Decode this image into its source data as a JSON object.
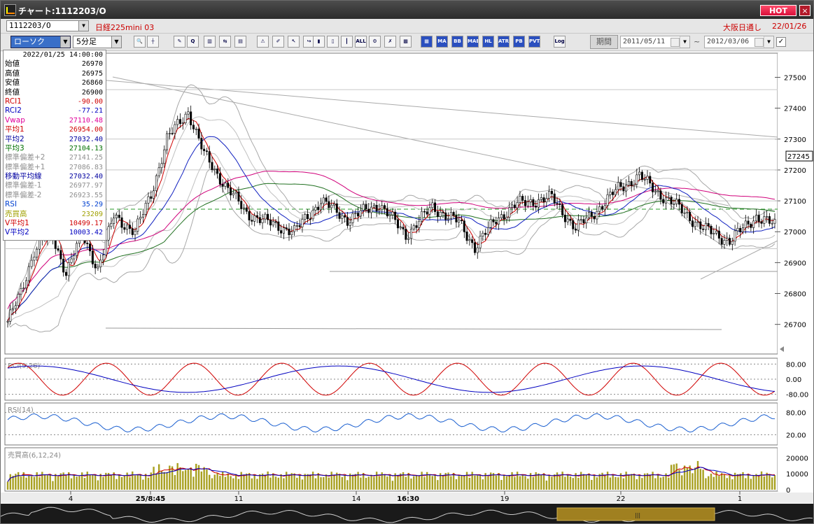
{
  "window": {
    "title": "チャート:1112203/O",
    "hot_label": "HOT",
    "close_label": "×"
  },
  "symbol": {
    "code": "1112203/O",
    "name": "日経225mini 03",
    "session": "大阪日通し",
    "date": "22/01/26"
  },
  "controls": {
    "chart_type": "ローソク",
    "interval": "5分足",
    "period_label": "期間",
    "date_from": "2011/05/11",
    "date_separator": "~",
    "date_to": "2012/03/06",
    "icons": [
      "search-icon",
      "crosshair-icon",
      "draw-icon",
      "zoom-icon",
      "chart-icon",
      "compare-icon",
      "memo-icon",
      "warning-icon",
      "pen-icon",
      "cursor-icon",
      "arrow-icon",
      "bar-icon",
      "bar2-icon",
      "candle-icon",
      "all-icon",
      "settings-icon",
      "tool-icon",
      "color-icon",
      "grid-icon",
      "ma-icon",
      "bb-icon",
      "mae-icon",
      "hl-icon",
      "atr-icon",
      "pb-icon",
      "pvt-icon",
      "log-icon"
    ],
    "icon_labels": [
      "🔍",
      "┼",
      "✎",
      "Q",
      "▥",
      "⇆",
      "▤",
      "⚠",
      "✐",
      "↖",
      "↪",
      "▮",
      "▯",
      "┃",
      "ALL",
      "⚙",
      "✗",
      "▩",
      "▦",
      "MA",
      "BB",
      "MAE",
      "HL",
      "ATR",
      "PB",
      "PVT",
      "Log"
    ]
  },
  "info_panel": {
    "timestamp": "2022/01/25  14:00:00",
    "rows": [
      {
        "label": "始値",
        "value": "26970",
        "color": "#000000"
      },
      {
        "label": "高値",
        "value": "26975",
        "color": "#000000"
      },
      {
        "label": "安値",
        "value": "26860",
        "color": "#000000"
      },
      {
        "label": "終値",
        "value": "26900",
        "color": "#000000"
      },
      {
        "label": "RCI1",
        "value": "-90.00",
        "color": "#d00000"
      },
      {
        "label": "RCI2",
        "value": "-77.21",
        "color": "#0000c0"
      },
      {
        "label": "Vwap",
        "value": "27110.48",
        "color": "#e0009a"
      },
      {
        "label": "平均1",
        "value": "26954.00",
        "color": "#d00000"
      },
      {
        "label": "平均2",
        "value": "27032.40",
        "color": "#0000a0"
      },
      {
        "label": "平均3",
        "value": "27104.13",
        "color": "#007000"
      },
      {
        "label": "標準偏差+2",
        "value": "27141.25",
        "color": "#909090"
      },
      {
        "label": "標準偏差+1",
        "value": "27086.83",
        "color": "#909090"
      },
      {
        "label": "移動平均線",
        "value": "27032.40",
        "color": "#0000a0"
      },
      {
        "label": "標準偏差-1",
        "value": "26977.97",
        "color": "#909090"
      },
      {
        "label": "標準偏差-2",
        "value": "26923.55",
        "color": "#909090"
      },
      {
        "label": "RSI",
        "value": "35.29",
        "color": "#0040d0"
      },
      {
        "label": "売買高",
        "value": "23209",
        "color": "#a0a000"
      },
      {
        "label": "V平均1",
        "value": "10499.17",
        "color": "#d00000"
      },
      {
        "label": "V平均2",
        "value": "10003.42",
        "color": "#0000c0"
      }
    ]
  },
  "chart_data": [
    {
      "type": "candlestick",
      "ylim": [
        26620,
        27560
      ],
      "y_ticks": [
        "27500",
        "27400",
        "27300",
        "27200",
        "27100",
        "27000",
        "26900",
        "26800",
        "26700"
      ],
      "current_price": "27245",
      "x_ticks": [
        "4",
        "25/8:45",
        "11",
        "14",
        "16:30",
        "19",
        "22",
        "1"
      ],
      "num_bars": 290,
      "path": [
        [
          0,
          26710
        ],
        [
          5,
          26800
        ],
        [
          10,
          26940
        ],
        [
          16,
          27000
        ],
        [
          22,
          26870
        ],
        [
          28,
          26990
        ],
        [
          34,
          26880
        ],
        [
          40,
          27050
        ],
        [
          48,
          27000
        ],
        [
          54,
          27120
        ],
        [
          60,
          27300
        ],
        [
          68,
          27390
        ],
        [
          74,
          27250
        ],
        [
          82,
          27150
        ],
        [
          90,
          27060
        ],
        [
          98,
          27030
        ],
        [
          108,
          27000
        ],
        [
          118,
          27100
        ],
        [
          128,
          27040
        ],
        [
          140,
          27090
        ],
        [
          150,
          26990
        ],
        [
          160,
          27080
        ],
        [
          170,
          27030
        ],
        [
          176,
          26950
        ],
        [
          184,
          27040
        ],
        [
          192,
          27090
        ],
        [
          205,
          27110
        ],
        [
          214,
          27010
        ],
        [
          222,
          27070
        ],
        [
          230,
          27140
        ],
        [
          238,
          27180
        ],
        [
          246,
          27120
        ],
        [
          254,
          27070
        ],
        [
          262,
          27010
        ],
        [
          272,
          26970
        ],
        [
          282,
          27050
        ],
        [
          289,
          27020
        ]
      ],
      "lines": {
        "rci_title": "RCI(9,26)",
        "rci_ticks": [
          "80.00",
          "0.00",
          "-80.00"
        ],
        "rsi_title": "RSI(14)",
        "rsi_ticks": [
          "80.00",
          "20.00"
        ],
        "volume_title": "売買高(6,12,24)",
        "volume_ticks": [
          "20000",
          "10000",
          "0"
        ]
      }
    }
  ]
}
